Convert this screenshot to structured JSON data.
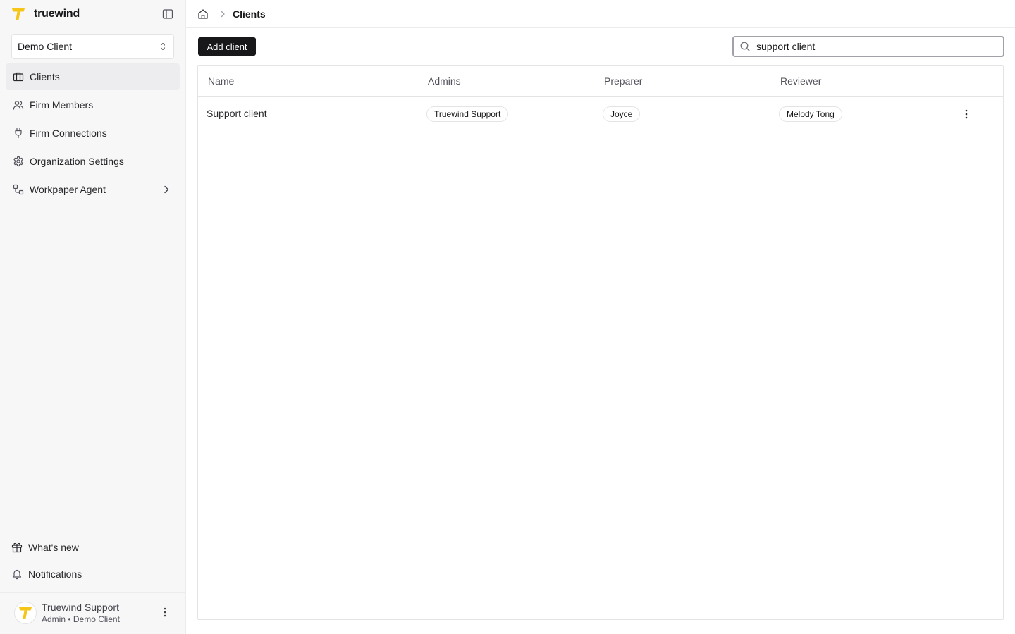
{
  "brand": {
    "name": "truewind",
    "logo_icon": "truewind-logo-icon",
    "accent": "#f5c518"
  },
  "client_switcher": {
    "selected": "Demo Client"
  },
  "sidebar": {
    "items": [
      {
        "label": "Clients",
        "icon": "briefcase-icon",
        "active": true
      },
      {
        "label": "Firm Members",
        "icon": "users-icon",
        "active": false
      },
      {
        "label": "Firm Connections",
        "icon": "plug-icon",
        "active": false
      },
      {
        "label": "Organization Settings",
        "icon": "gear-icon",
        "active": false
      },
      {
        "label": "Workpaper Agent",
        "icon": "workflow-icon",
        "active": false
      }
    ],
    "bottom": {
      "whats_new": "What's new",
      "notifications": "Notifications"
    },
    "user": {
      "name": "Truewind Support",
      "role": "Admin • Demo Client"
    }
  },
  "breadcrumb": {
    "current": "Clients"
  },
  "toolbar": {
    "add_label": "Add client"
  },
  "search": {
    "value": "support client",
    "placeholder": ""
  },
  "table": {
    "headers": {
      "name": "Name",
      "admins": "Admins",
      "preparer": "Preparer",
      "reviewer": "Reviewer"
    },
    "rows": [
      {
        "name": "Support client",
        "admin": "Truewind Support",
        "preparer": "Joyce",
        "reviewer": "Melody Tong"
      }
    ]
  }
}
